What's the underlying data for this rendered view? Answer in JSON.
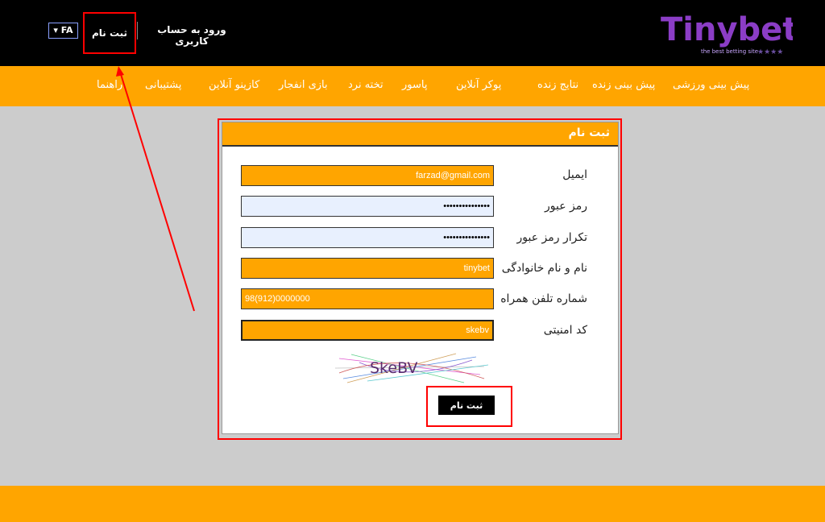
{
  "header": {
    "logo_text": "Tinybet",
    "logo_tagline": "the best betting site",
    "lang": "FA",
    "register": "ثبت نام",
    "login": "ورود به حساب کاربری"
  },
  "menu": [
    "پیش بینی ورزشی",
    "پیش بینی زنده",
    "نتایج زنده",
    "پوکر آنلاین",
    "پاسور",
    "تخته نرد",
    "بازی انفجار",
    "کازینو آنلاین",
    "پشتیبانی",
    "راهنما"
  ],
  "form": {
    "title": "ثبت نام",
    "fields": [
      {
        "label": "ایمیل",
        "value": "farzad@gmail.com"
      },
      {
        "label": "رمز عبور",
        "value": "•••••••••••••••"
      },
      {
        "label": "تکرار رمز عبور",
        "value": "•••••••••••••••"
      },
      {
        "label": "نام و نام خانوادگی",
        "value": "tinybet"
      },
      {
        "label": "شماره تلفن همراه",
        "value": "98(912)0000000"
      },
      {
        "label": "کد امنیتی",
        "value": "skebv"
      }
    ],
    "captcha_text": "SkeBV",
    "submit": "ثبت نام"
  },
  "colors": {
    "accent": "#ffa500",
    "header_bg": "#000000",
    "page_bg": "#cccccc",
    "highlight": "#ff0000"
  }
}
